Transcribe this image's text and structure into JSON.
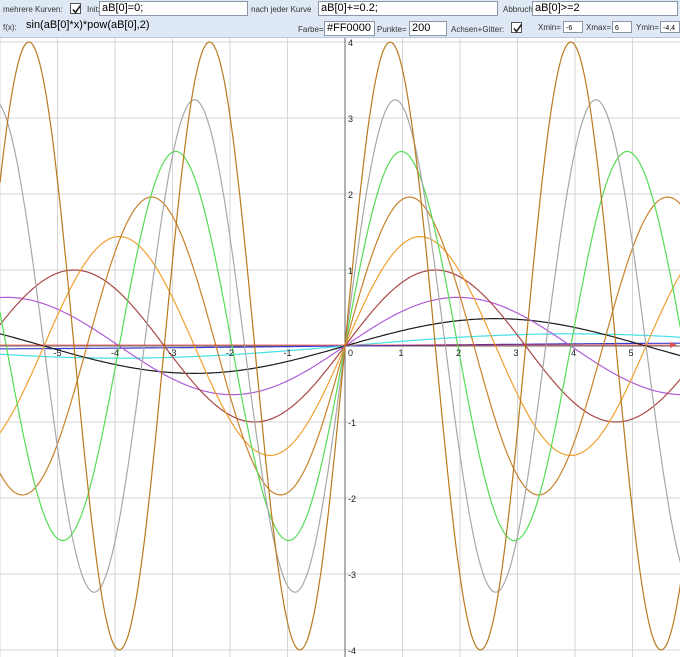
{
  "toolbar": {
    "row1": {
      "multi_label": "mehrere Kurven:",
      "multi_checked": true,
      "init_label": "Init:",
      "init_value": "aB[0]=0;",
      "after_label": "nach jeder Kurve",
      "after_value": "aB[0]+=0.2;",
      "abort_label": "Abbruch",
      "abort_value": "aB[0]>=2"
    },
    "row2": {
      "fx_label": "f(x):",
      "fx_value": "sin(aB[0]*x)*pow(aB[0],2)",
      "color_label": "Farbe=",
      "color_value": "#FF0000",
      "points_label": "Punkte=",
      "points_value": "200",
      "axes_label": "Achsen+Gitter:",
      "axes_checked": true,
      "xmin_label": "Xmin=",
      "xmin_value": "-6",
      "xmax_label": "Xmax=",
      "xmax_value": "6",
      "ymin_label": "Ymin=",
      "ymin_value": "-4,4"
    }
  },
  "chart_data": {
    "type": "line",
    "function": "sin(a*x)*pow(a,2)",
    "x_range": [
      -6,
      6
    ],
    "y_range": [
      -4,
      4
    ],
    "x_ticks": [
      -5,
      -4,
      -3,
      -2,
      -1,
      1,
      2,
      3,
      4,
      5
    ],
    "y_ticks": [
      -4,
      -3,
      -2,
      -1,
      1,
      2,
      3,
      4
    ],
    "grid": true,
    "series": [
      {
        "a": 0.2,
        "color": "#3a3acc"
      },
      {
        "a": 0.4,
        "color": "#44e0e6"
      },
      {
        "a": 0.6,
        "color": "#1a1a1a"
      },
      {
        "a": 0.8,
        "color": "#b05bd8"
      },
      {
        "a": 1.0,
        "color": "#a84848"
      },
      {
        "a": 1.2,
        "color": "#f0a030"
      },
      {
        "a": 1.4,
        "color": "#c8822c"
      },
      {
        "a": 1.6,
        "color": "#55dd55"
      },
      {
        "a": 1.8,
        "color": "#a8a8a8"
      },
      {
        "a": 2.0,
        "color": "#b87a1e"
      }
    ]
  }
}
